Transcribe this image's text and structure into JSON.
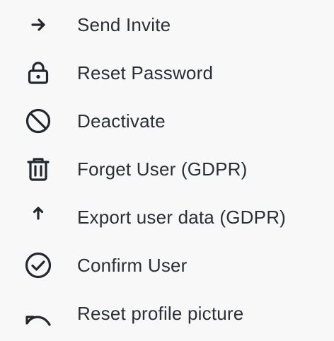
{
  "menu": {
    "items": [
      {
        "label": "Send Invite",
        "icon": "arrow-right-icon"
      },
      {
        "label": "Reset Password",
        "icon": "lock-icon"
      },
      {
        "label": "Deactivate",
        "icon": "block-icon"
      },
      {
        "label": "Forget User (GDPR)",
        "icon": "trash-icon"
      },
      {
        "label": "Export user data (GDPR)",
        "icon": "arrow-up-icon"
      },
      {
        "label": "Confirm User",
        "icon": "check-circle-icon"
      },
      {
        "label": "Reset profile picture",
        "icon": "undo-icon"
      }
    ]
  }
}
